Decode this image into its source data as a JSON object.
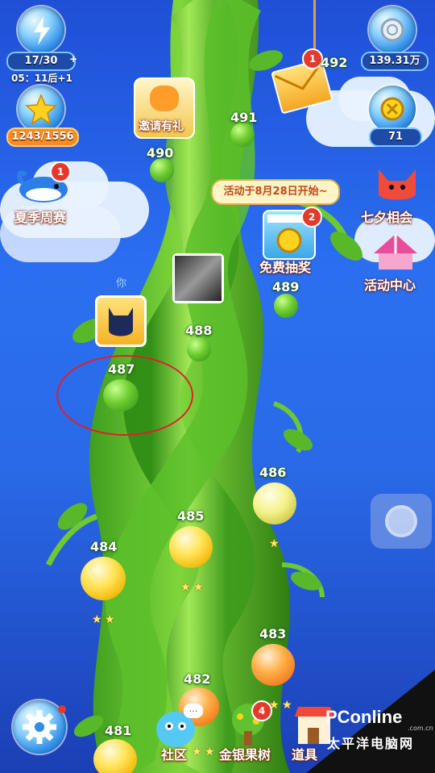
{
  "hud": {
    "energy": "17/30",
    "energy_timer": "05：11后+1",
    "stars": "1243/1556",
    "coins": "139.31万",
    "gems": "71"
  },
  "events": {
    "invite_label": "邀请有礼",
    "summer_label": "夏季周赛",
    "summer_badge": "1",
    "qixi_label": "七夕相会",
    "activity_label": "活动中心",
    "lottery_label": "免费抽奖",
    "lottery_badge": "2",
    "mail_badge": "1",
    "activity_notice": "活动于8月28日开始~"
  },
  "map": {
    "you_label": "你",
    "levels": {
      "l481": "481",
      "l482": "482",
      "l483": "483",
      "l484": "484",
      "l485": "485",
      "l486": "486",
      "l487": "487",
      "l488": "488",
      "l489": "489",
      "l490": "490",
      "l491": "491",
      "l492": "492"
    }
  },
  "bottom": {
    "community_label": "社区",
    "tree_label": "金银果树",
    "tree_badge": "4",
    "tools_label": "道具"
  },
  "watermark": {
    "brand": "PConline",
    "sub": "太平洋电脑网",
    "domain": ".com.cn"
  }
}
